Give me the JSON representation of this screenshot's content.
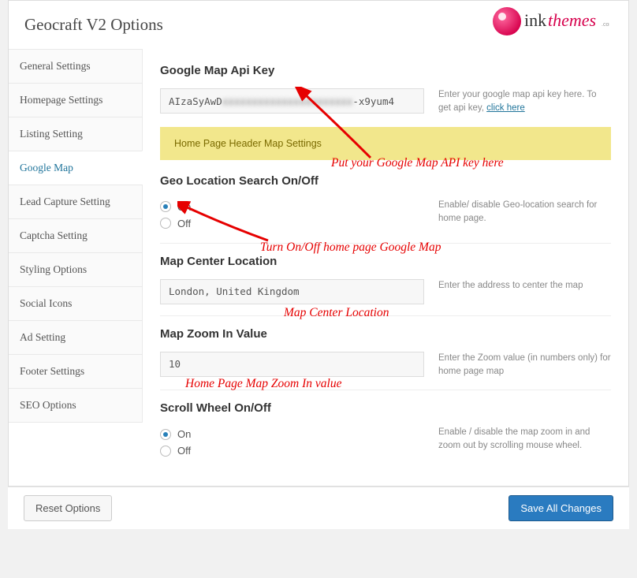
{
  "header": {
    "title": "Geocraft V2 Options",
    "logo_text": "inkthemes",
    "logo_suffix": ".com"
  },
  "sidebar": {
    "items": [
      {
        "label": "General Settings"
      },
      {
        "label": "Homepage Settings"
      },
      {
        "label": "Listing Setting"
      },
      {
        "label": "Google Map",
        "active": true
      },
      {
        "label": "Lead Capture Setting"
      },
      {
        "label": "Captcha Setting"
      },
      {
        "label": "Styling Options"
      },
      {
        "label": "Social Icons"
      },
      {
        "label": "Ad Setting"
      },
      {
        "label": "Footer Settings"
      },
      {
        "label": "SEO Options"
      }
    ]
  },
  "sections": {
    "api_key": {
      "title": "Google Map Api Key",
      "value_prefix": "AIzaSyAwD",
      "value_obscured": "xxxxxxxxxxxxxxxxxxxxxx",
      "value_suffix": "-x9yum4",
      "desc": "Enter your google map api key here. To get api key, ",
      "link": "click here"
    },
    "header_bar": "Home Page Header Map Settings",
    "geo_search": {
      "title": "Geo Location Search On/Off",
      "on": "On",
      "off": "Off",
      "selected": "on",
      "desc": "Enable/ disable Geo-location search for home page."
    },
    "center": {
      "title": "Map Center Location",
      "value": "London, United Kingdom",
      "desc": "Enter the address to center the map"
    },
    "zoom": {
      "title": "Map Zoom In Value",
      "value": "10",
      "desc": "Enter the Zoom value (in numbers only) for home page map"
    },
    "scroll": {
      "title": "Scroll Wheel On/Off",
      "on": "On",
      "off": "Off",
      "selected": "on",
      "desc": "Enable / disable the map zoom in and zoom out by scrolling mouse wheel."
    }
  },
  "footer": {
    "reset": "Reset Options",
    "save": "Save All Changes"
  },
  "annotations": {
    "api": "Put your Google Map API key here",
    "onoff": "Turn On/Off home page Google Map",
    "center": "Map Center Location",
    "zoom": "Home Page Map Zoom In value"
  }
}
